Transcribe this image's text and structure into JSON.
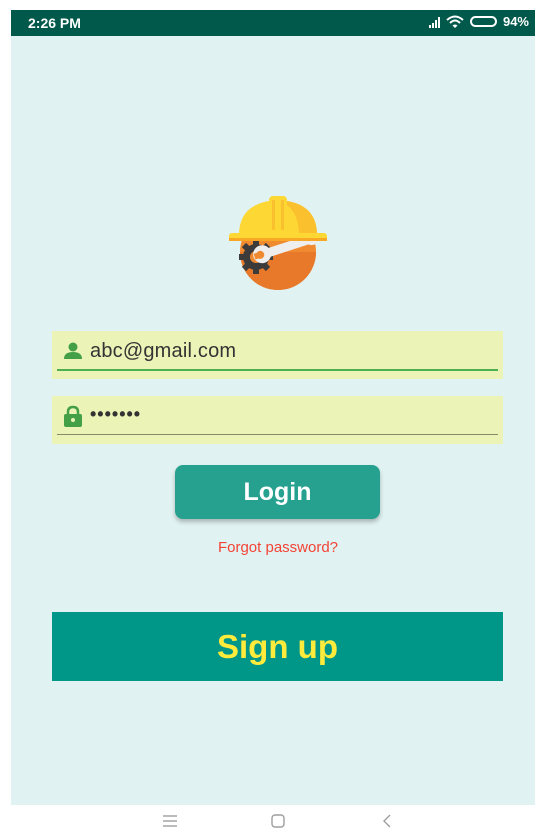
{
  "status_bar": {
    "time": "2:26 PM",
    "battery_percent": "94%",
    "icons": [
      "signal-icon",
      "wifi-icon",
      "battery-icon"
    ]
  },
  "logo": {
    "icon": "hard-hat-wrench-gear-icon"
  },
  "form": {
    "email": {
      "value": "abc@gmail.com",
      "icon": "person-icon"
    },
    "password": {
      "value": "•••••••",
      "icon": "lock-icon"
    },
    "login_label": "Login",
    "forgot_label": "Forgot password?",
    "signup_label": "Sign up"
  },
  "nav_bar": {
    "icons": [
      "menu-icon",
      "home-icon",
      "back-icon"
    ]
  },
  "colors": {
    "status_bar": "#00594a",
    "background": "#e0f2f1",
    "field_background": "#ecf3b7",
    "login_button": "#26a190",
    "signup_button": "#009688",
    "signup_text": "#ffeb3b",
    "forgot_text": "#f44336",
    "icon_green": "#43a047"
  }
}
